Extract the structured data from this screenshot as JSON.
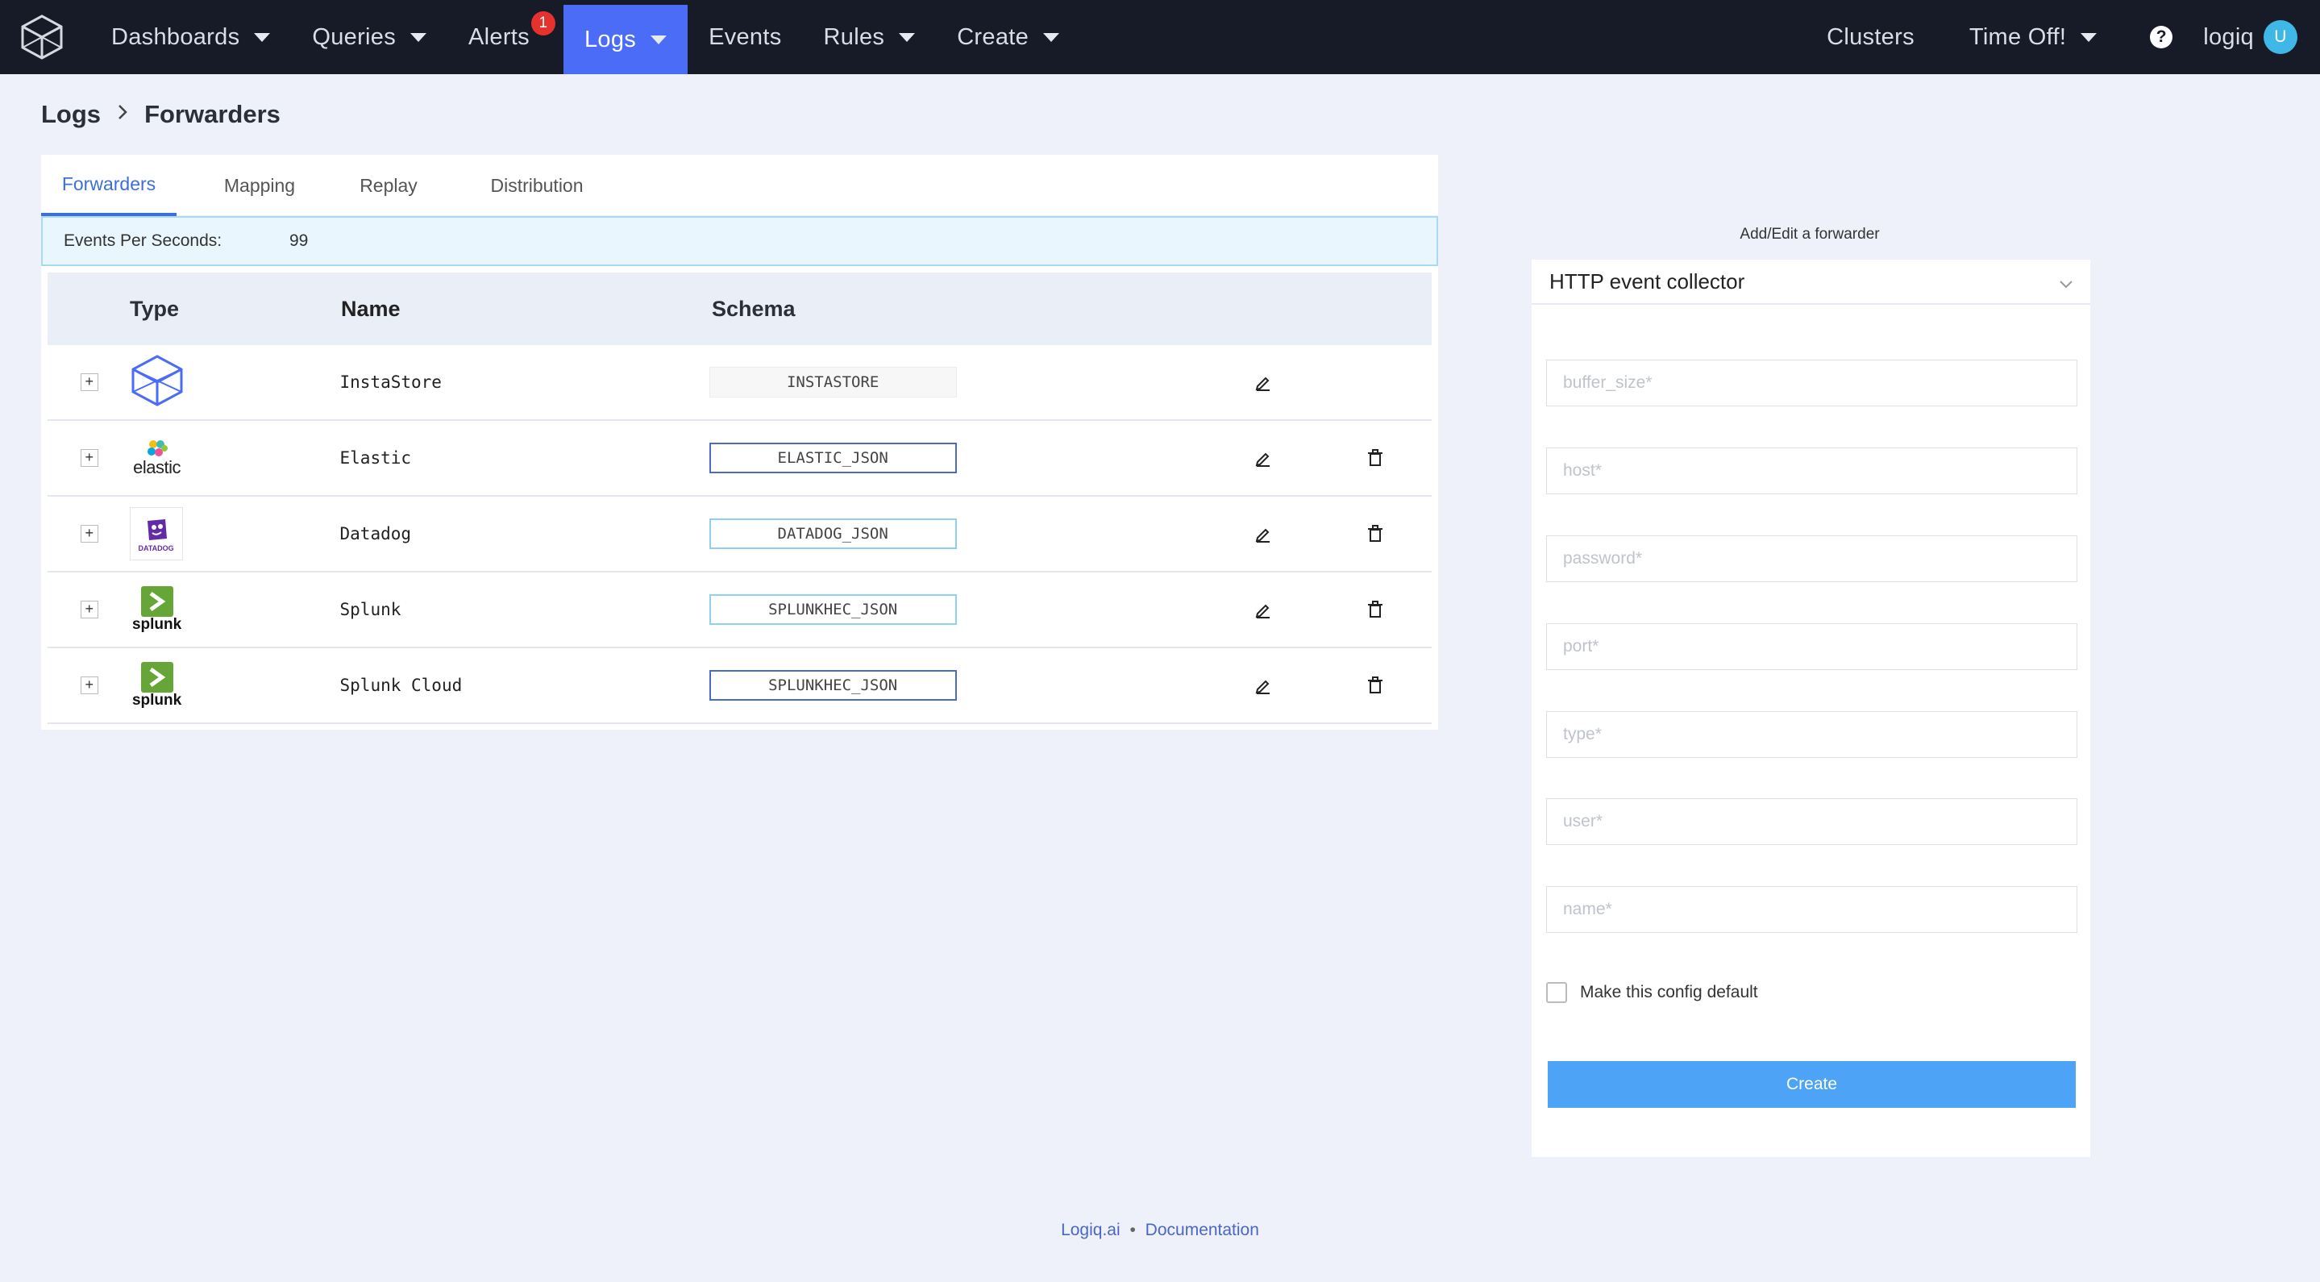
{
  "navbar": {
    "items": [
      {
        "label": "Dashboards",
        "dropdown": true
      },
      {
        "label": "Queries",
        "dropdown": true
      },
      {
        "label": "Alerts",
        "badge": "1"
      },
      {
        "label": "Logs",
        "dropdown": true,
        "active": true
      },
      {
        "label": "Events"
      },
      {
        "label": "Rules",
        "dropdown": true
      },
      {
        "label": "Create",
        "dropdown": true
      }
    ],
    "right": {
      "clusters": "Clusters",
      "time_off": "Time Off!",
      "help": "?",
      "user": "logiq",
      "avatar_initial": "U"
    },
    "accent_color": "#4a6cf7"
  },
  "breadcrumb": {
    "parent": "Logs",
    "current": "Forwarders"
  },
  "tabs": [
    "Forwarders",
    "Mapping",
    "Replay",
    "Distribution"
  ],
  "eps": {
    "label": "Events Per Seconds:",
    "value": "99"
  },
  "table": {
    "headers": {
      "type": "Type",
      "name": "Name",
      "schema": "Schema"
    },
    "rows": [
      {
        "type_icon": "instastore-logo-icon",
        "name": "InstaStore",
        "schema": "INSTASTORE",
        "deletable": false
      },
      {
        "type_icon": "elastic-logo-icon",
        "name": "Elastic",
        "schema": "ELASTIC_JSON",
        "deletable": true
      },
      {
        "type_icon": "datadog-logo-icon",
        "name": "Datadog",
        "schema": "DATADOG_JSON",
        "deletable": true
      },
      {
        "type_icon": "splunk-logo-icon",
        "name": "Splunk",
        "schema": "SPLUNKHEC_JSON",
        "deletable": true
      },
      {
        "type_icon": "splunk-logo-icon",
        "name": "Splunk Cloud",
        "schema": "SPLUNKHEC_JSON",
        "deletable": true
      }
    ],
    "logos": {
      "elastic": "elastic",
      "datadog": "DATADOG",
      "splunk": "splunk"
    }
  },
  "form": {
    "title": "Add/Edit a forwarder",
    "selected_type": "HTTP event collector",
    "fields": [
      {
        "placeholder": "buffer_size*",
        "value": ""
      },
      {
        "placeholder": "host*",
        "value": ""
      },
      {
        "placeholder": "password*",
        "value": ""
      },
      {
        "placeholder": "port*",
        "value": ""
      },
      {
        "placeholder": "type*",
        "value": ""
      },
      {
        "placeholder": "user*",
        "value": ""
      },
      {
        "placeholder": "name*",
        "value": ""
      }
    ],
    "default_checkbox_label": "Make this config default",
    "default_checked": false,
    "submit_label": "Create",
    "submit_color": "#4da3f5"
  },
  "footer": {
    "site": "Logiq.ai",
    "separator": "•",
    "docs": "Documentation"
  }
}
